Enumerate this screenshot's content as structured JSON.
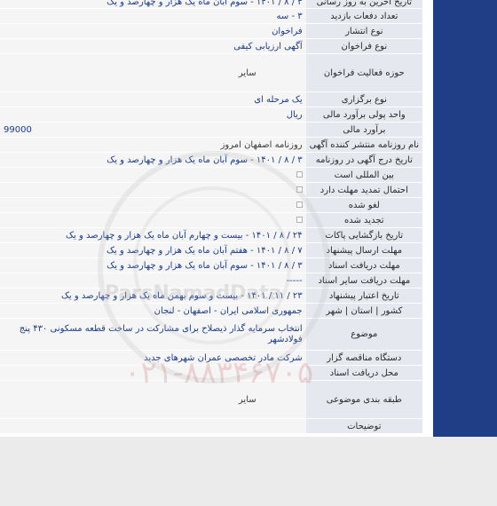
{
  "rows": [
    {
      "label": "تاریخ آخرین به روز رسانی",
      "value": "۳ / ۸ / ۱۴۰۱ - سوم آبان ماه یک هزار و چهارصد و یک",
      "blue": true
    },
    {
      "label": "تعداد دفعات بازدید",
      "value": "۳ - سه",
      "blue": true
    },
    {
      "label": "نوع انتشار",
      "value": "فراخوان",
      "blue": true
    },
    {
      "label": "نوع فراخوان",
      "value": "آگهی ارزیابی کیفی",
      "blue": true
    },
    {
      "label": "حوزه فعالیت فراخوان",
      "value": "سایر",
      "blue": false
    },
    {
      "label": "نوع برگزاری",
      "value": "یک مرحله ای",
      "blue": true
    },
    {
      "label": "واحد پولی برآورد مالی",
      "value": "ریال",
      "blue": true
    },
    {
      "label": "برآورد مالی",
      "value": "99000",
      "blue": true
    },
    {
      "label": "نام روزنامه منتشر کننده آگهی",
      "value": "روزنامه اصفهان امروز",
      "blue": false
    },
    {
      "label": "تاریخ درج آگهی در روزنامه",
      "value": "۳ / ۸ / ۱۴۰۱ - سوم آبان ماه یک هزار و چهارصد و یک",
      "blue": true
    },
    {
      "label": "بین المللی است",
      "value": "",
      "blue": false
    },
    {
      "label": "احتمال تمدید مهلت دارد",
      "value": "",
      "blue": false
    },
    {
      "label": "لغو شده",
      "value": "",
      "blue": false
    },
    {
      "label": "تجدید شده",
      "value": "",
      "blue": false
    },
    {
      "label": "تاریخ بازگشایی پاکات",
      "value": "۲۴ / ۸ / ۱۴۰۱ - بیست و چهارم آبان ماه یک هزار و چهارصد و یک",
      "blue": true
    },
    {
      "label": "مهلت ارسال پیشنهاد",
      "value": "۷ / ۸ / ۱۴۰۱ - هفتم آبان ماه یک هزار و چهارصد و یک",
      "blue": true
    },
    {
      "label": "مهلت دریافت اسناد",
      "value": "۳ / ۸ / ۱۴۰۱ - سوم آبان ماه یک هزار و چهارصد و یک",
      "blue": true
    },
    {
      "label": "مهلت دریافت سایر اسناد",
      "value": "-----",
      "blue": true
    },
    {
      "label": "تاریخ اعتبار پیشنهاد",
      "value": "۲۳ / ۱۱ / ۱۴۰۱ - بیست و سوم بهمن ماه یک هزار و چهارصد و یک",
      "blue": true
    },
    {
      "label": "کشور | استان | شهر",
      "value": "جمهوری اسلامی ایران - اصفهان - لنجان",
      "blue": true
    },
    {
      "label": "موضوع",
      "value": "انتخاب سرمایه گذار ذیصلاح برای مشارکت در ساخت قطعه مسکونی ۴۳۰ پنج فولادشهر",
      "blue": true
    },
    {
      "label": "دستگاه مناقصه گزار",
      "value": "شرکت مادر تخصصی عمران شهرهای جدید",
      "blue": true
    },
    {
      "label": "محل دریافت اسناد",
      "value": "",
      "blue": false
    },
    {
      "label": "طبقه بندی موضوعی",
      "value": "سایر",
      "blue": false
    },
    {
      "label": "توضیحات",
      "value": "",
      "blue": false
    }
  ],
  "watermark": {
    "brand": "ParsNamadData",
    "phone": "۰۲۱-۸۸۳۴۶۷۰۵"
  },
  "colors": {
    "label_bg": "#e5e8ef",
    "value_bg": "#f5f5f5",
    "value_text": "#1b3a8c",
    "sidebar": "#1f3e86"
  }
}
